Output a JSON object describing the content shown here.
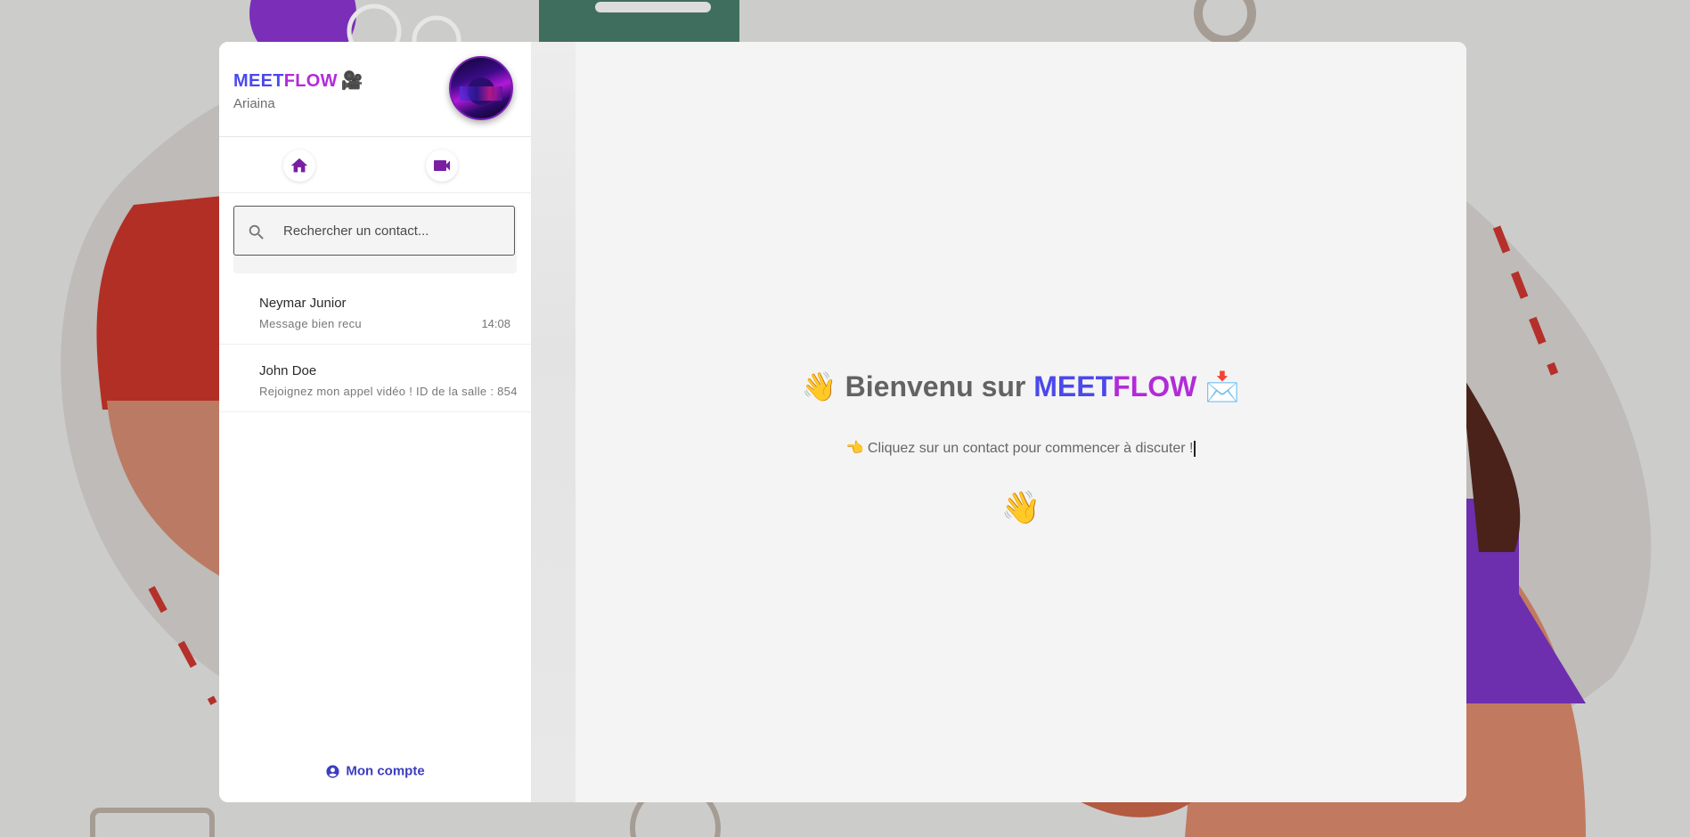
{
  "app": {
    "brand_meet": "MEET",
    "brand_flow": "FLOW",
    "brand_emoji": "🎥",
    "user_name": "Ariaina",
    "colors": {
      "meet": "#4b48ec",
      "flow": "#b22bd8",
      "accent": "#7b1fa2",
      "link": "#3c3dbf"
    }
  },
  "nav": {
    "items": [
      {
        "icon": "home-icon"
      },
      {
        "icon": "videocam-icon"
      }
    ]
  },
  "search": {
    "placeholder": "Rechercher un contact...",
    "value": ""
  },
  "contacts": [
    {
      "name": "Neymar Junior",
      "last_message": "Message bien recu",
      "time": "14:08"
    },
    {
      "name": "John Doe",
      "last_message": "Rejoignez mon appel vidéo ! ID de la salle : 854",
      "time": ""
    }
  ],
  "account": {
    "label": "Mon compte",
    "icon": "account-circle-icon"
  },
  "welcome": {
    "title_prefix": "👋 Bienvenu sur ",
    "title_meet": "MEET",
    "title_flow": "FLOW",
    "title_suffix": " 📩",
    "subtitle": "👈 Cliquez sur un contact pour commencer à discuter !",
    "emoji": "👋"
  }
}
